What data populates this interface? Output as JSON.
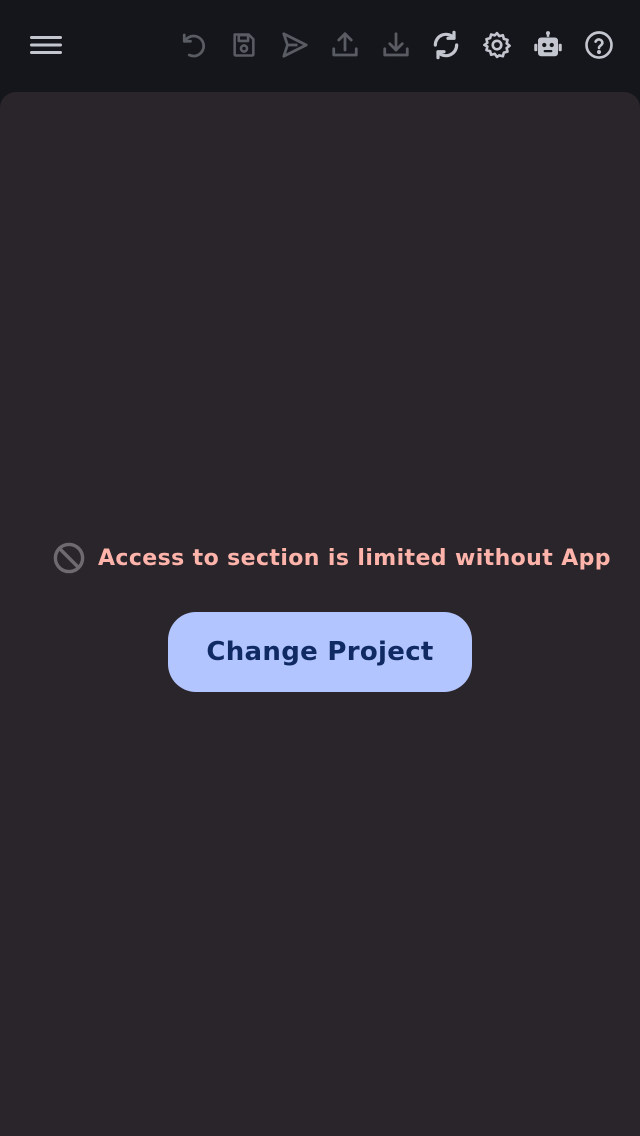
{
  "toolbar": {
    "menu_icon": "menu-icon",
    "actions": [
      {
        "name": "undo-icon",
        "enabled": false
      },
      {
        "name": "save-icon",
        "enabled": false
      },
      {
        "name": "send-icon",
        "enabled": false
      },
      {
        "name": "upload-icon",
        "enabled": false
      },
      {
        "name": "download-icon",
        "enabled": false
      },
      {
        "name": "sync-icon",
        "enabled": true
      },
      {
        "name": "settings-icon",
        "enabled": true
      },
      {
        "name": "robot-icon",
        "enabled": true
      },
      {
        "name": "help-icon",
        "enabled": true
      }
    ],
    "colors": {
      "enabled": "#c4c6cf",
      "disabled": "#5a5c63"
    }
  },
  "main": {
    "notice": {
      "icon": "block-icon",
      "text": "Access to section is limited without App"
    },
    "change_project_label": "Change Project"
  },
  "colors": {
    "toolbar_bg": "#15161b",
    "panel_bg": "#2a252a",
    "notice_text": "#ffb4ab",
    "button_bg": "#b3c5ff",
    "button_text": "#102a63"
  }
}
